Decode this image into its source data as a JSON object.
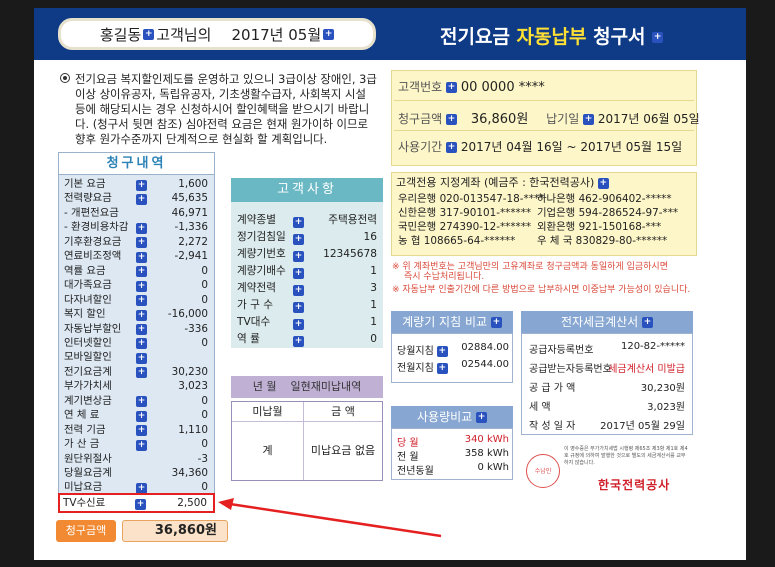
{
  "header": {
    "customer_name": "홍길동",
    "customer_suffix": "고객님의",
    "bill_month": "2017년 05월",
    "title_prefix": "전기요금",
    "title_highlight": "자동납부",
    "title_suffix": "청구서"
  },
  "notice": "전기요금 복지할인제도를 운영하고 있으니 3급이상 장애인, 3급이상 상이유공자, 독립유공자, 기초생활수급자, 사회복지 시설 등에 해당되시는 경우 신청하시어 할인혜택을 받으시기 바랍니다. (청구서 뒷면 참조) 심야전력 요금은 현재 원가이하 이므로 향후 원가수준까지 단계적으로 현실화 할 계획입니다.",
  "billing": {
    "title": "청구내역",
    "items": [
      {
        "label": "기본 요금",
        "value": "1,600",
        "plus": true
      },
      {
        "label": "전력량요금",
        "value": "45,635",
        "plus": true
      },
      {
        "label": "- 개편전요금",
        "value": "46,971",
        "plus": false
      },
      {
        "label": "- 환경비용차감",
        "value": "-1,336",
        "plus": true
      },
      {
        "label": "기후환경요금",
        "value": "2,272",
        "plus": true
      },
      {
        "label": "연료비조정액",
        "value": "-2,941",
        "plus": true
      },
      {
        "label": "역률 요금",
        "value": "0",
        "plus": true
      },
      {
        "label": "대가족요금",
        "value": "0",
        "plus": true
      },
      {
        "label": "다자녀할인",
        "value": "0",
        "plus": true
      },
      {
        "label": "복지 할인",
        "value": "-16,000",
        "plus": true
      },
      {
        "label": "자동납부할인",
        "value": "-336",
        "plus": true
      },
      {
        "label": "인터넷할인",
        "value": "0",
        "plus": true
      },
      {
        "label": "모바일할인",
        "value": "",
        "plus": true
      },
      {
        "label": "전기요금계",
        "value": "30,230",
        "plus": true
      },
      {
        "label": "부가가치세",
        "value": "3,023",
        "plus": false
      },
      {
        "label": "계기변상금",
        "value": "0",
        "plus": true
      },
      {
        "label": "연 체 료",
        "value": "0",
        "plus": true
      },
      {
        "label": "전력 기금",
        "value": "1,110",
        "plus": true
      },
      {
        "label": "가 산 금",
        "value": "0",
        "plus": true
      },
      {
        "label": "원단위절사",
        "value": "-3",
        "plus": false
      },
      {
        "label": "당월요금계",
        "value": "34,360",
        "plus": false
      },
      {
        "label": "미납요금",
        "value": "0",
        "plus": true
      }
    ],
    "tv_label": "TV수신료",
    "tv_value": "2,500",
    "total_label": "청구금액",
    "total_value": "36,860원"
  },
  "customer": {
    "title": "고객사항",
    "items": [
      {
        "label": "계약종별",
        "value": "주택용전력"
      },
      {
        "label": "정기검침일",
        "value": "16"
      },
      {
        "label": "계량기번호",
        "value": "12345678"
      },
      {
        "label": "계량기배수",
        "value": "1"
      },
      {
        "label": "계약전력",
        "value": "3"
      },
      {
        "label": "가 구 수",
        "value": "1"
      },
      {
        "label": "TV대수",
        "value": "1"
      },
      {
        "label": "역 률",
        "value": "0"
      }
    ]
  },
  "arrears": {
    "title_col1": "년 월",
    "title_col2": "일현재미납내역",
    "head1": "미납월",
    "head2": "금 액",
    "cell1": "계",
    "cell2": "미납요금 없음"
  },
  "summary": {
    "customer_no_label": "고객번호",
    "customer_no": "00 0000 ****",
    "amount_label": "청구금액",
    "amount": "36,860원",
    "due_label": "납기일",
    "due": "2017년 06월 05일",
    "period_label": "사용기간",
    "period": "2017년 04월 16일 ~ 2017년 05월 15일"
  },
  "accounts": {
    "title": "고객전용 지정계좌 (예금주 : 한국전력공사)",
    "list": [
      {
        "bank": "우리은행",
        "no": "020-013547-18-****"
      },
      {
        "bank": "하나은행",
        "no": "462-906402-*****"
      },
      {
        "bank": "신한은행",
        "no": "317-90101-******"
      },
      {
        "bank": "기업은행",
        "no": "594-286524-97-***"
      },
      {
        "bank": "국민은행",
        "no": "274390-12-******"
      },
      {
        "bank": "외환은행",
        "no": "921-150168-***"
      },
      {
        "bank": "농 협",
        "no": "108665-64-******"
      },
      {
        "bank": "우 체 국",
        "no": "830829-80-******"
      }
    ]
  },
  "notes": {
    "note1": "※ 위 계좌번호는 고객님만의 고유계좌로 청구금액과 동일하게 입금하시면",
    "note1b": "즉시 수납처리됩니다.",
    "note2": "※ 자동납부 인출기간에 다른 방법으로 납부하시면 이중납부 가능성이 있습니다."
  },
  "meter": {
    "title": "계량기 지침 비교",
    "rows": [
      {
        "label": "당월지침",
        "value": "02884.00"
      },
      {
        "label": "전월지침",
        "value": "02544.00"
      }
    ]
  },
  "usage": {
    "title": "사용량비교",
    "rows": [
      {
        "label": "당 월",
        "value": "340 kWh"
      },
      {
        "label": "전 월",
        "value": "358 kWh"
      },
      {
        "label": "전년동월",
        "value": "0 kWh"
      }
    ]
  },
  "tax": {
    "title": "전자세금계산서",
    "rows": [
      {
        "label": "공급자등록번호",
        "value": "120-82-*****"
      },
      {
        "label": "공급받는자등록번호",
        "value": "세금계산서 미발급"
      },
      {
        "label": "공 급 가 액",
        "value": "30,230원"
      },
      {
        "label": "세 액",
        "value": "3,023원"
      },
      {
        "label": "작 성 일 자",
        "value": "2017년 05월 29일"
      }
    ],
    "stamp": "수납인",
    "stamp_note": "이 영수증은 부가가치세법 시행령 제65조 제3항 제1호 제4호 규정에 의하여 발행한 것으로 별도의 세금계산서를 교부하지 않습니다.",
    "logo": "한국전력공사"
  },
  "colors": {
    "header_bg": "#0f3a86",
    "highlight": "#ffe033",
    "plus_icon": "#2a52be",
    "red_box": "#e52020"
  }
}
